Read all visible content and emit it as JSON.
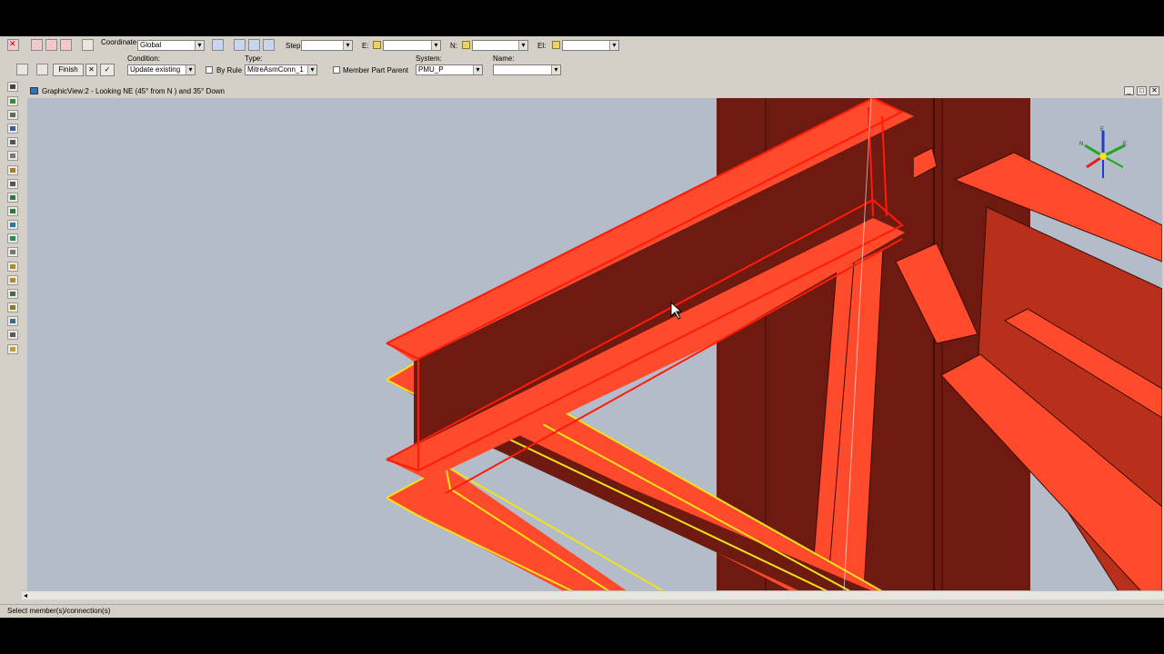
{
  "toolbar1": {
    "coordinate_label": "Coordinate system:",
    "coordinate_value": "Global",
    "step_label": "Step:",
    "step_value": "",
    "e_label": "E:",
    "e_value": "",
    "n_label": "N:",
    "n_value": "",
    "el_label": "El:",
    "el_value": ""
  },
  "toolbar2": {
    "finish_label": "Finish",
    "cancel_symbol": "✕",
    "accept_symbol": "✓",
    "condition_label": "Condition:",
    "condition_value": "Update existing",
    "by_rule_label": "By Rule",
    "type_label": "Type:",
    "type_value": "MitreAsmConn_1",
    "member_part_parent_label": "Member Part Parent",
    "system_label": "System:",
    "system_value": "PMU_P",
    "name_label": "Name:",
    "name_value": ""
  },
  "graphic_view": {
    "title": "GraphicView:2 - Looking NE (45° from N ) and 35° Down",
    "compass": {
      "up": "E",
      "west": "N",
      "east": "E"
    }
  },
  "status_bar": {
    "text": "Select member(s)/connection(s)"
  },
  "colors": {
    "background": "#b4bcca",
    "member_red": "#ff4a2c",
    "member_dark": "#6e1a10",
    "highlight_red": "#ff1a0a",
    "highlight_yellow": "#f2e21a"
  },
  "icons": [
    "select-arrow-icon",
    "place-member-icon",
    "grid-icon",
    "connection-icon",
    "plate-icon",
    "finish-flag-icon",
    "cursor-icon"
  ]
}
